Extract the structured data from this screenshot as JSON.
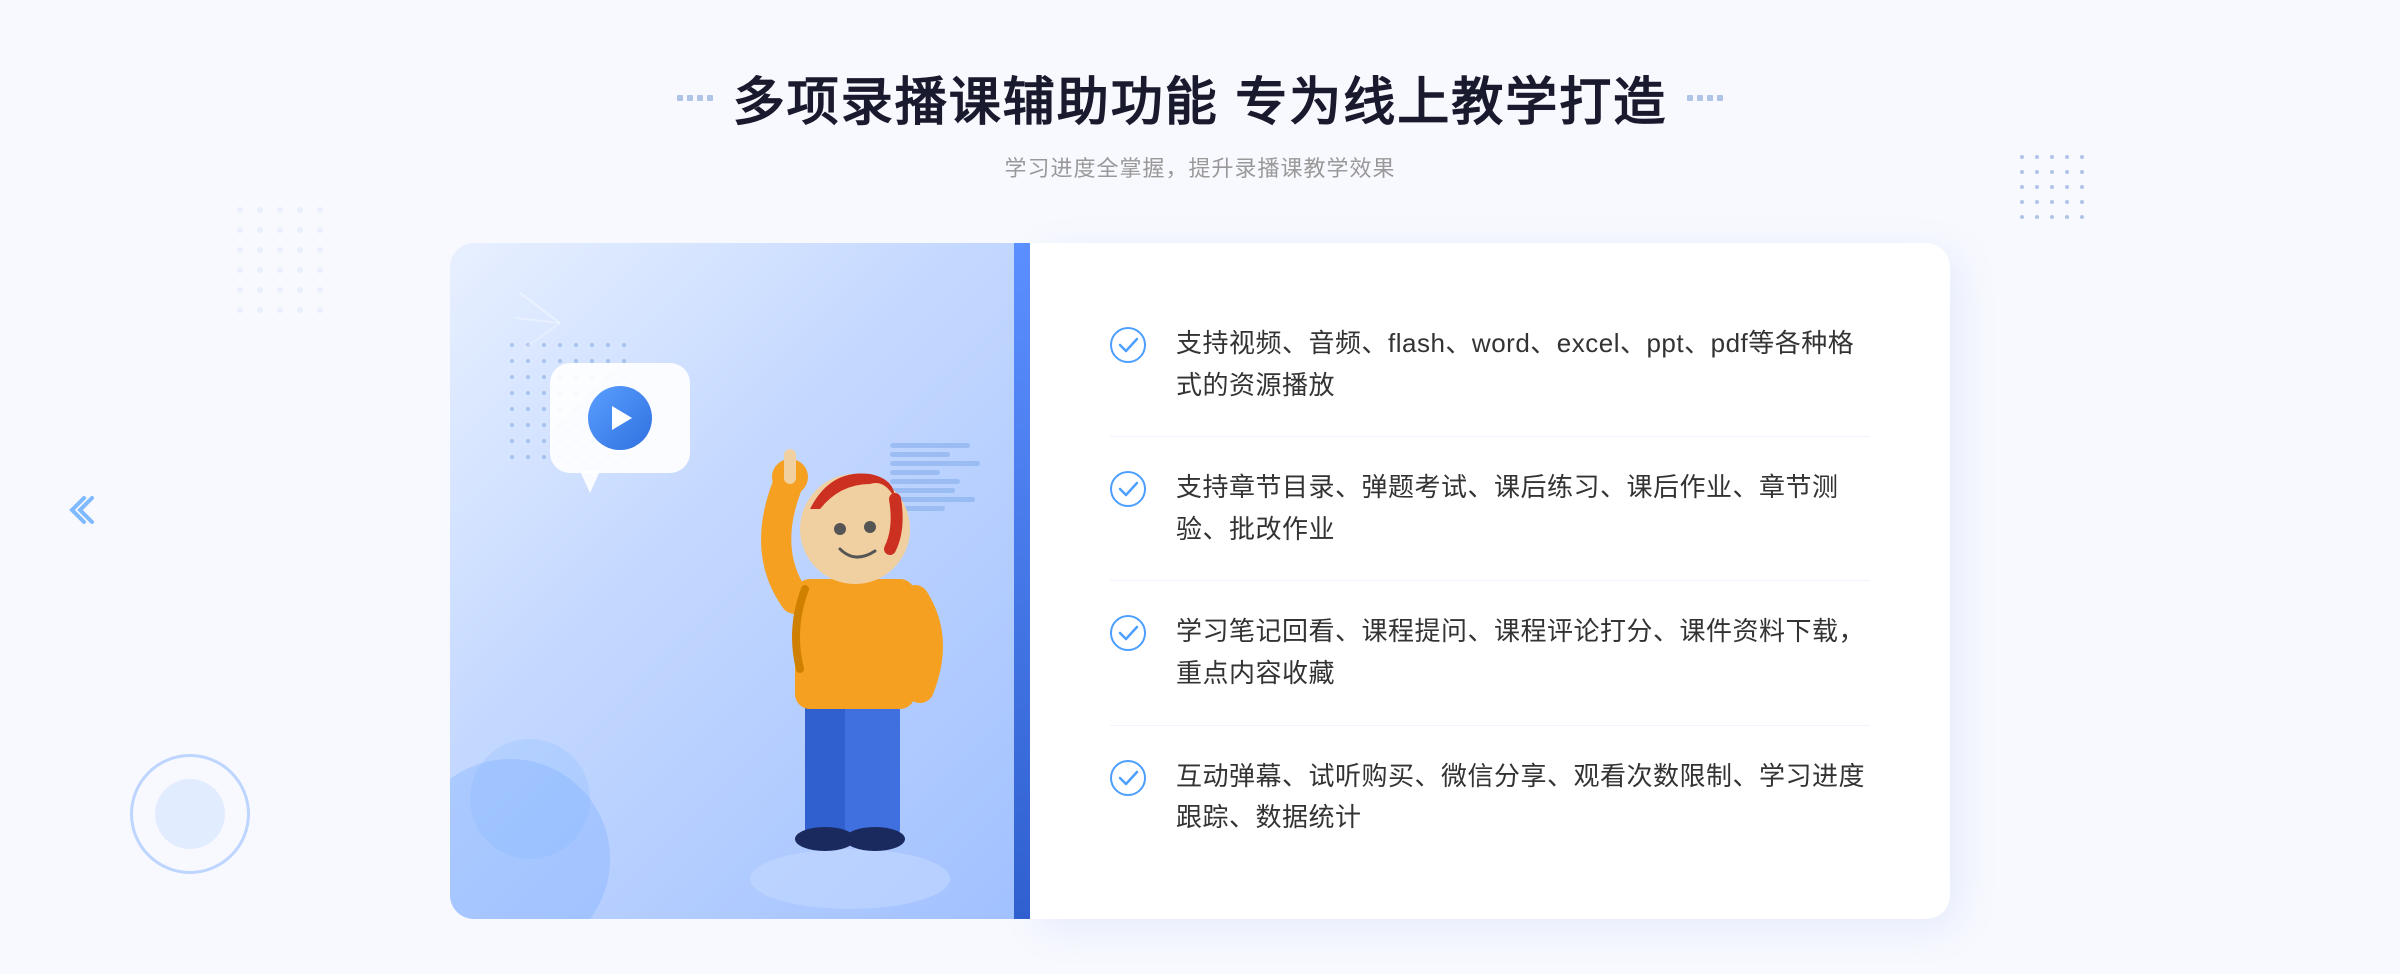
{
  "page": {
    "background_color": "#f5f7ff"
  },
  "header": {
    "title": "多项录播课辅助功能 专为线上教学打造",
    "subtitle": "学习进度全掌握，提升录播课教学效果",
    "decoration_left": "⁚⁚",
    "decoration_right": "⁚⁚"
  },
  "features": [
    {
      "id": 1,
      "text": "支持视频、音频、flash、word、excel、ppt、pdf等各种格式的资源播放"
    },
    {
      "id": 2,
      "text": "支持章节目录、弹题考试、课后练习、课后作业、章节测验、批改作业"
    },
    {
      "id": 3,
      "text": "学习笔记回看、课程提问、课程评论打分、课件资料下载，重点内容收藏"
    },
    {
      "id": 4,
      "text": "互动弹幕、试听购买、微信分享、观看次数限制、学习进度跟踪、数据统计"
    }
  ],
  "icons": {
    "check": "check-circle-icon",
    "play": "play-icon",
    "chevron": "chevron-right-icon"
  },
  "colors": {
    "primary": "#3d7eff",
    "primary_dark": "#2255cc",
    "text_dark": "#1a1a2e",
    "text_medium": "#333333",
    "text_light": "#999999",
    "bg_light": "#f5f7ff",
    "accent": "#5b8eff"
  }
}
